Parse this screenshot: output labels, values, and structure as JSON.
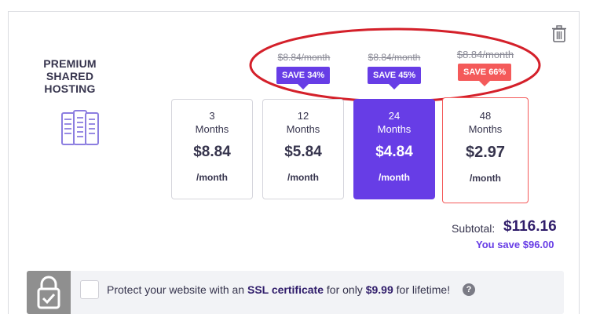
{
  "product": {
    "title": "PREMIUM SHARED HOSTING",
    "icon": "server-stack-icon"
  },
  "periods": [
    {
      "length": "3",
      "unit": "Months",
      "price": "$8.84",
      "per": "/month",
      "selected": false
    },
    {
      "length": "12",
      "unit": "Months",
      "price": "$5.84",
      "per": "/month",
      "selected": false,
      "old_price": "$8.84/month",
      "badge": "SAVE 34%"
    },
    {
      "length": "24",
      "unit": "Months",
      "price": "$4.84",
      "per": "/month",
      "selected": true,
      "old_price": "$8.84/month",
      "badge": "SAVE 45%"
    },
    {
      "length": "48",
      "unit": "Months",
      "price": "$2.97",
      "per": "/month",
      "selected": false,
      "old_price": "$8.84/month",
      "badge": "SAVE 66%"
    }
  ],
  "summary": {
    "subtotal_label": "Subtotal:",
    "subtotal_value": "$116.16",
    "you_save": "You save $96.00"
  },
  "ssl": {
    "text_before": "Protect your website with an ",
    "text_bold": "SSL certificate",
    "text_middle": " for only ",
    "price": "$9.99",
    "text_after": " for lifetime!",
    "help": "?"
  },
  "colors": {
    "brand_purple": "#673de6",
    "save_red": "#f45a5a",
    "annotation_red": "#d4202a",
    "ssl_bar_bg": "#f2f3f6"
  },
  "icons": [
    "trash-icon",
    "server-stack-icon",
    "lock-check-icon",
    "question-circle-icon"
  ]
}
